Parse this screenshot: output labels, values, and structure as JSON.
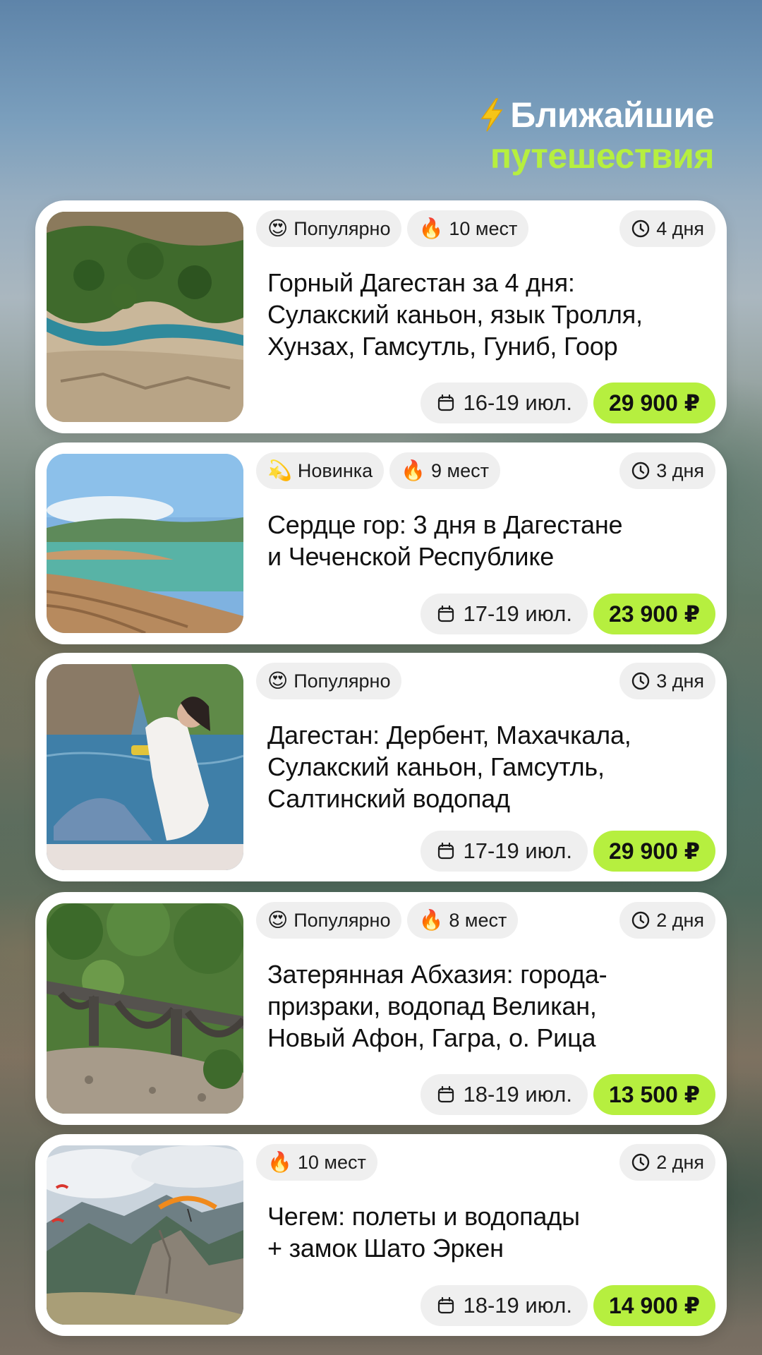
{
  "header": {
    "line1": "Ближайшие",
    "line2": "путешествия",
    "icon": "lightning-icon"
  },
  "colors": {
    "accent": "#b6ef3f",
    "chip_bg": "#efefef",
    "card_bg": "#ffffff"
  },
  "tours": [
    {
      "badge": {
        "emoji": "😍",
        "label": "Популярно"
      },
      "seats": {
        "emoji": "🔥",
        "label": "10 мест"
      },
      "duration": "4 дня",
      "title_lines": [
        "Горный Дагестан за 4 дня:",
        "Сулакский каньон, язык Тролля,",
        "Хунзах, Гамсутль, Гуниб, Гоор"
      ],
      "dates": "16-19 июл.",
      "price": "29 900 ₽",
      "photo": "canyon-river"
    },
    {
      "badge": {
        "emoji": "💫",
        "label": "Новинка"
      },
      "seats": {
        "emoji": "🔥",
        "label": "9 мест"
      },
      "duration": "3 дня",
      "title_lines": [
        "Сердце гор: 3 дня в Дагестане",
        "и Чеченской Республике"
      ],
      "dates": "17-19 июл.",
      "price": "23 900 ₽",
      "photo": "turquoise-lake"
    },
    {
      "badge": {
        "emoji": "😍",
        "label": "Популярно"
      },
      "duration": "3 дня",
      "title_lines": [
        "Дагестан: Дербент, Махачкала,",
        "Сулакский каньон, Гамсутль,",
        "Салтинский водопад"
      ],
      "dates": "17-19 июл.",
      "price": "29 900 ₽",
      "photo": "woman-on-boat"
    },
    {
      "badge": {
        "emoji": "😍",
        "label": "Популярно"
      },
      "seats": {
        "emoji": "🔥",
        "label": "8 мест"
      },
      "duration": "2 дня",
      "title_lines": [
        "Затерянная Абхазия: города-",
        "призраки, водопад Великан,",
        "Новый Афон, Гагра, о. Рица"
      ],
      "dates": "18-19 июл.",
      "price": "13 500 ₽",
      "photo": "old-bridge"
    },
    {
      "seats": {
        "emoji": "🔥",
        "label": "10 мест"
      },
      "duration": "2 дня",
      "title_lines": [
        "Чегем: полеты и водопады",
        "+ замок Шато Эркен"
      ],
      "dates": "18-19 июл.",
      "price": "14 900 ₽",
      "photo": "paragliders-mountains"
    }
  ]
}
